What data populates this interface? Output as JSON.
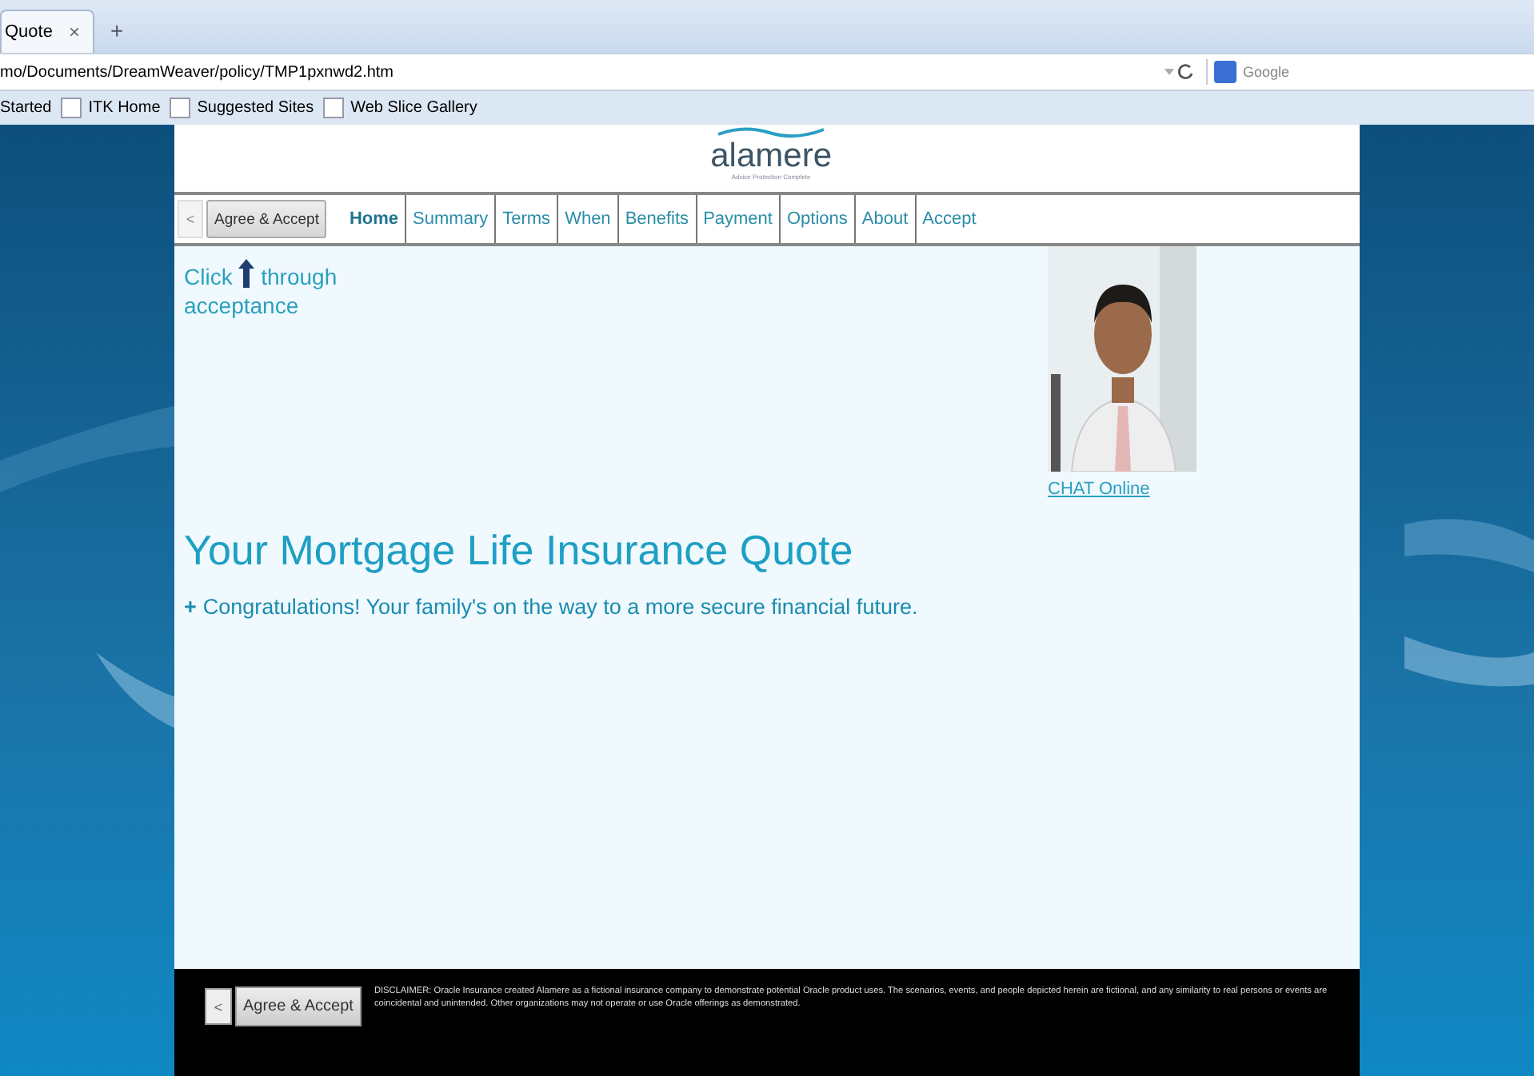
{
  "browser": {
    "tabs": [
      {
        "label": "Quote",
        "selected": true
      }
    ],
    "new_tab": "+",
    "tab_close": "×",
    "address": "mo/Documents/DreamWeaver/policy/TMP1pxnwd2.htm",
    "search_placeholder": "Google",
    "favorites": [
      "Started",
      "ITK Home",
      "Suggested Sites",
      "Web Slice Gallery"
    ]
  },
  "header": {
    "logo": "alamere",
    "tagline": "Advice Protection Complete"
  },
  "nav": {
    "back": "<",
    "agree": "Agree & Accept",
    "items": [
      {
        "label": "Home",
        "selected": true
      },
      {
        "label": "Summary",
        "selected": false
      },
      {
        "label": "Terms",
        "selected": false
      },
      {
        "label": "When",
        "selected": false
      },
      {
        "label": "Benefits",
        "selected": false
      },
      {
        "label": "Payment",
        "selected": false
      },
      {
        "label": "Options",
        "selected": false
      },
      {
        "label": "About",
        "selected": false
      },
      {
        "label": "Accept",
        "selected": false
      }
    ]
  },
  "annotation": {
    "before": "Click",
    "after": "through",
    "second_line": "acceptance"
  },
  "chat_link": "CHAT Online",
  "title": "Your Mortgage Life Insurance Quote",
  "bullet": "+",
  "message": "Congratulations! Your family's on the way to a more secure financial future.",
  "footer": {
    "back": "<",
    "agree": "Agree & Accept",
    "disclaimer": "DISCLAIMER: Oracle Insurance created Alamere as a fictional insurance company to demonstrate potential Oracle product uses. The scenarios, events, and people depicted herein are fictional, and any similarity to real persons or events are coincidental and unintended. Other organizations may not operate or use Oracle offerings as demonstrated."
  }
}
